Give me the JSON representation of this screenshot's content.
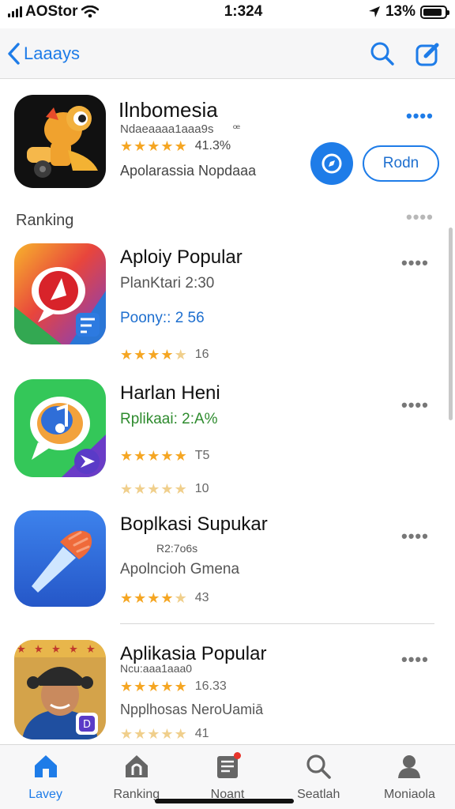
{
  "status": {
    "carrier": "AOStor",
    "time": "1:324",
    "battery": "13%",
    "battery_level": 0.9
  },
  "nav": {
    "back_label": "Laaays",
    "search_icon": "search-icon",
    "compose_icon": "compose-icon"
  },
  "featured": {
    "title": "Ilnbomesia",
    "subtitle": "Ndaeaaaa1aaa9s",
    "subtitle_mark": "ꟹ",
    "rating_value": "41.3%",
    "description": "Apolarassia Nopdaaa",
    "open_button": "Rodn",
    "stars": 5
  },
  "section": {
    "title": "Ranking"
  },
  "apps": [
    {
      "title": "Aploiy Popular",
      "line1": "PlanKtari 2:30",
      "line2": "Poony:: 2 56",
      "line2_color": "#1e6fcf",
      "stars": 4,
      "rating_count": "16"
    },
    {
      "title": "Harlan Heni",
      "line1": "Rplikaai: 2:A%",
      "line1_color": "#2e8b2e",
      "stars": 5,
      "rating_count": "T5",
      "stars2": 4,
      "rating_count2": "10"
    },
    {
      "title": "Boplkasi Supukar",
      "subline": "R2:7o6s",
      "line1": "Apolncioh Gmena",
      "stars": 4,
      "rating_count": "43"
    },
    {
      "title": "Aplikasia Popular",
      "subline": "Ncu:aaa1aaa0",
      "rating_value": "16.33",
      "line1": "Npplhosas NeroUamiā",
      "stars": 5,
      "stars2": 4,
      "rating_count2": "41"
    }
  ],
  "tabs": [
    {
      "label": "Lavey",
      "icon": "home-icon"
    },
    {
      "label": "Ranking",
      "icon": "ranking-icon"
    },
    {
      "label": "Noant",
      "icon": "news-icon"
    },
    {
      "label": "Seatlah",
      "icon": "search-icon"
    },
    {
      "label": "Moniaola",
      "icon": "profile-icon"
    }
  ],
  "colors": {
    "accent": "#1e7ce8",
    "star": "#f5a623",
    "badge": "#e8342b"
  }
}
